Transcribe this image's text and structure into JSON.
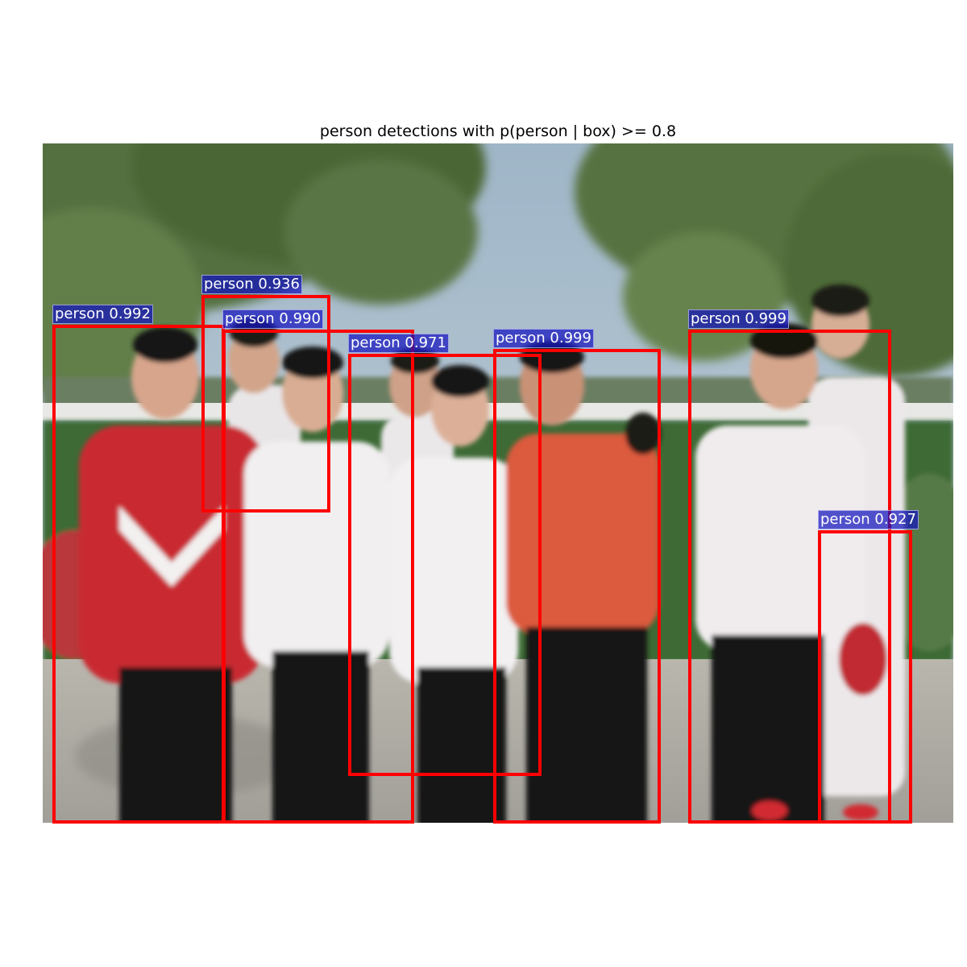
{
  "title": "person detections with p(person | box) >= 0.8",
  "colors": {
    "box": "#ff0000",
    "label_bg": "#1c1cbf",
    "label_text": "#ffffff"
  },
  "detections": [
    {
      "label": "person 0.992"
    },
    {
      "label": "person 0.936"
    },
    {
      "label": "person 0.990"
    },
    {
      "label": "person 0.971"
    },
    {
      "label": "person 0.999"
    },
    {
      "label": "person 0.999"
    },
    {
      "label": "person 0.927"
    }
  ]
}
